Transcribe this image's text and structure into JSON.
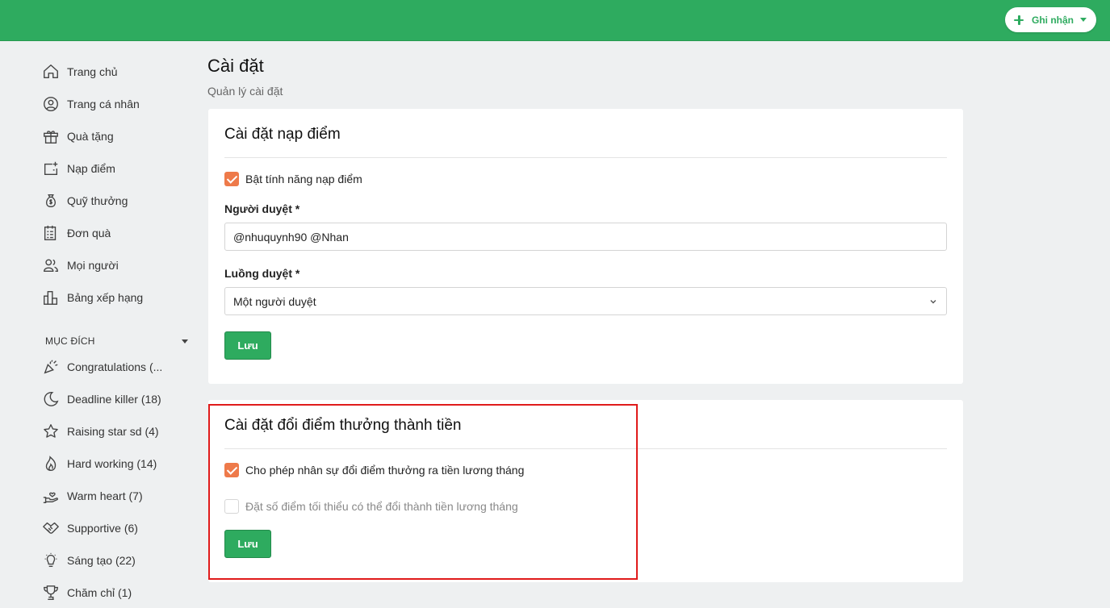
{
  "header": {
    "action_label": "Ghi nhận"
  },
  "sidebar": {
    "items": [
      {
        "label": "Trang chủ",
        "icon": "home-icon"
      },
      {
        "label": "Trang cá nhân",
        "icon": "user-circle-icon"
      },
      {
        "label": "Quà tặng",
        "icon": "gift-icon"
      },
      {
        "label": "Nạp điểm",
        "icon": "wallet-plus-icon"
      },
      {
        "label": "Quỹ thưởng",
        "icon": "money-bag-icon"
      },
      {
        "label": "Đơn quà",
        "icon": "order-list-icon"
      },
      {
        "label": "Mọi người",
        "icon": "people-icon"
      },
      {
        "label": "Bảng xếp hạng",
        "icon": "leaderboard-icon"
      }
    ],
    "section_title": "MỤC ĐÍCH",
    "purposes": [
      {
        "label": "Congratulations (...",
        "icon": "party-popper-icon"
      },
      {
        "label": "Deadline killer (18)",
        "icon": "moon-icon"
      },
      {
        "label": "Raising star sd (4)",
        "icon": "star-icon"
      },
      {
        "label": "Hard working (14)",
        "icon": "flame-icon"
      },
      {
        "label": "Warm heart (7)",
        "icon": "hand-heart-icon"
      },
      {
        "label": "Supportive (6)",
        "icon": "handshake-icon"
      },
      {
        "label": "Sáng tạo (22)",
        "icon": "lightbulb-icon"
      },
      {
        "label": "Chăm chỉ (1)",
        "icon": "trophy-icon"
      }
    ]
  },
  "page": {
    "title": "Cài đặt",
    "subtitle": "Quản lý cài đặt"
  },
  "topup_settings": {
    "title": "Cài đặt nạp điểm",
    "enable_label": "Bật tính năng nạp điểm",
    "enable_checked": true,
    "approver_label": "Người duyệt *",
    "approver_value": "@nhuquynh90 @Nhan",
    "flow_label": "Luồng duyệt *",
    "flow_value": "Một người duyệt",
    "save_label": "Lưu"
  },
  "exchange_settings": {
    "title": "Cài đặt đổi điểm thưởng thành tiền",
    "allow_label": "Cho phép nhân sự đổi điểm thưởng ra tiền lương tháng",
    "allow_checked": true,
    "min_label": "Đặt số điểm tối thiểu có thể đổi thành tiền lương tháng",
    "min_checked": false,
    "save_label": "Lưu"
  },
  "colors": {
    "brand_green": "#2eab5f",
    "checkbox_orange": "#ee7a4a",
    "highlight_red": "#e01b1b"
  }
}
